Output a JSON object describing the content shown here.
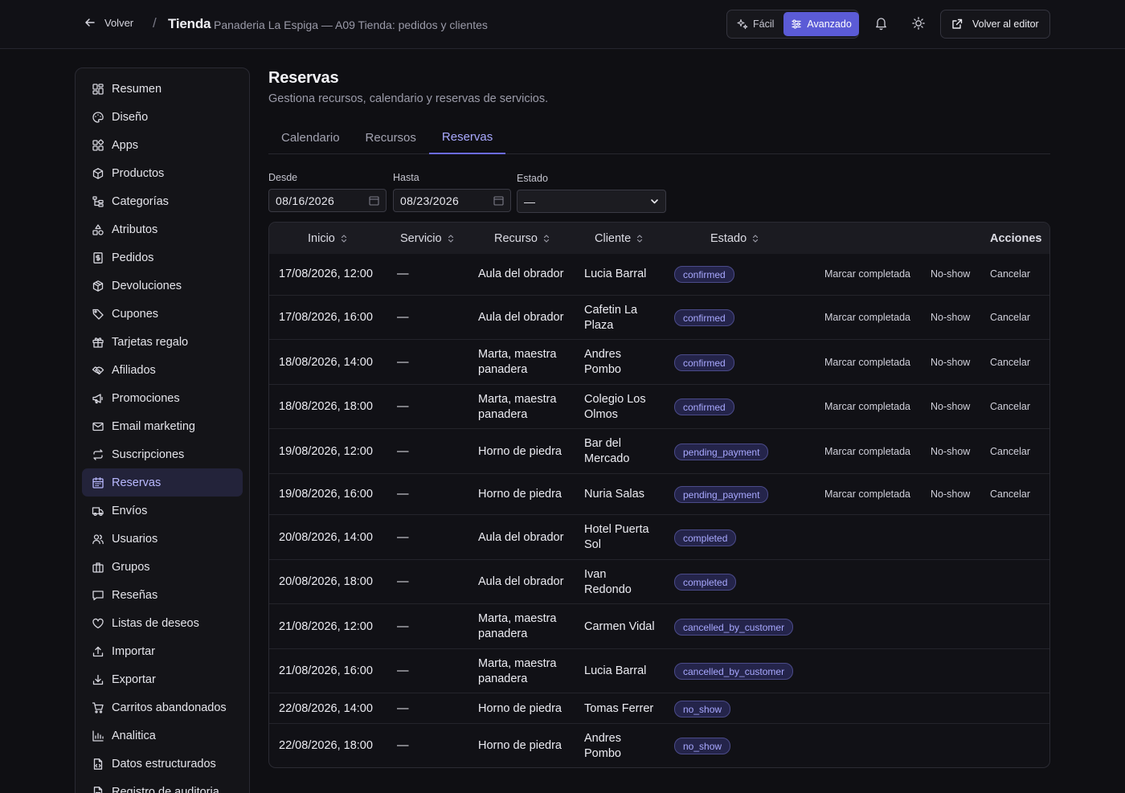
{
  "header": {
    "back_label": "Volver",
    "separator": "/",
    "title": "Tienda",
    "subtitle": "Panaderia La Espiga — A09 Tienda: pedidos y clientes",
    "mode_easy": "Fácil",
    "mode_advanced": "Avanzado",
    "editor_button": "Volver al editor"
  },
  "sidebar": {
    "items": [
      {
        "label": "Resumen",
        "icon": "dashboard-icon"
      },
      {
        "label": "Diseño",
        "icon": "palette-icon"
      },
      {
        "label": "Apps",
        "icon": "apps-icon"
      },
      {
        "label": "Productos",
        "icon": "box-icon"
      },
      {
        "label": "Categorías",
        "icon": "tree-icon"
      },
      {
        "label": "Atributos",
        "icon": "shapes-icon"
      },
      {
        "label": "Pedidos",
        "icon": "receipt-icon"
      },
      {
        "label": "Devoluciones",
        "icon": "return-box-icon"
      },
      {
        "label": "Cupones",
        "icon": "tag-icon"
      },
      {
        "label": "Tarjetas regalo",
        "icon": "gift-icon"
      },
      {
        "label": "Afiliados",
        "icon": "handshake-icon"
      },
      {
        "label": "Promociones",
        "icon": "megaphone-icon"
      },
      {
        "label": "Email marketing",
        "icon": "mail-icon"
      },
      {
        "label": "Suscripciones",
        "icon": "repeat-icon"
      },
      {
        "label": "Reservas",
        "icon": "calendar-icon",
        "active": true
      },
      {
        "label": "Envíos",
        "icon": "truck-icon"
      },
      {
        "label": "Usuarios",
        "icon": "users-icon"
      },
      {
        "label": "Grupos",
        "icon": "groups-icon"
      },
      {
        "label": "Reseñas",
        "icon": "message-icon"
      },
      {
        "label": "Listas de deseos",
        "icon": "heart-icon"
      },
      {
        "label": "Importar",
        "icon": "upload-icon"
      },
      {
        "label": "Exportar",
        "icon": "download-icon"
      },
      {
        "label": "Carritos abandonados",
        "icon": "cart-icon"
      },
      {
        "label": "Analitica",
        "icon": "bar-chart-icon"
      },
      {
        "label": "Datos estructurados",
        "icon": "file-code-icon"
      },
      {
        "label": "Registro de auditoria",
        "icon": "file-list-icon"
      }
    ]
  },
  "page": {
    "title": "Reservas",
    "subtitle": "Gestiona recursos, calendario y reservas de servicios.",
    "tabs": [
      {
        "label": "Calendario",
        "active": false
      },
      {
        "label": "Recursos",
        "active": false
      },
      {
        "label": "Reservas",
        "active": true
      }
    ]
  },
  "filters": {
    "from_label": "Desde",
    "from_value": "08/16/2026",
    "to_label": "Hasta",
    "to_value": "08/23/2026",
    "status_label": "Estado",
    "status_value": "—"
  },
  "table": {
    "headers": {
      "start": "Inicio",
      "service": "Servicio",
      "resource": "Recurso",
      "client": "Cliente",
      "status": "Estado",
      "actions": "Acciones"
    },
    "action_labels": {
      "complete": "Marcar completada",
      "no_show": "No-show",
      "cancel": "Cancelar"
    },
    "rows": [
      {
        "start": "17/08/2026, 12:00",
        "service": "—",
        "resource": [
          "Aula del obrador"
        ],
        "client": [
          "Lucia Barral"
        ],
        "status": "confirmed",
        "actions": true
      },
      {
        "start": "17/08/2026, 16:00",
        "service": "—",
        "resource": [
          "Aula del obrador"
        ],
        "client": [
          "Cafetin La",
          "Plaza"
        ],
        "status": "confirmed",
        "actions": true
      },
      {
        "start": "18/08/2026, 14:00",
        "service": "—",
        "resource": [
          "Marta, maestra",
          "panadera"
        ],
        "client": [
          "Andres",
          "Pombo"
        ],
        "status": "confirmed",
        "actions": true
      },
      {
        "start": "18/08/2026, 18:00",
        "service": "—",
        "resource": [
          "Marta, maestra",
          "panadera"
        ],
        "client": [
          "Colegio Los",
          "Olmos"
        ],
        "status": "confirmed",
        "actions": true
      },
      {
        "start": "19/08/2026, 12:00",
        "service": "—",
        "resource": [
          "Horno de piedra"
        ],
        "client": [
          "Bar del",
          "Mercado"
        ],
        "status": "pending_payment",
        "actions": true
      },
      {
        "start": "19/08/2026, 16:00",
        "service": "—",
        "resource": [
          "Horno de piedra"
        ],
        "client": [
          "Nuria Salas"
        ],
        "status": "pending_payment",
        "actions": true
      },
      {
        "start": "20/08/2026, 14:00",
        "service": "—",
        "resource": [
          "Aula del obrador"
        ],
        "client": [
          "Hotel Puerta",
          "Sol"
        ],
        "status": "completed",
        "actions": false
      },
      {
        "start": "20/08/2026, 18:00",
        "service": "—",
        "resource": [
          "Aula del obrador"
        ],
        "client": [
          "Ivan",
          "Redondo"
        ],
        "status": "completed",
        "actions": false
      },
      {
        "start": "21/08/2026, 12:00",
        "service": "—",
        "resource": [
          "Marta, maestra",
          "panadera"
        ],
        "client": [
          "Carmen Vidal"
        ],
        "status": "cancelled_by_customer",
        "actions": false
      },
      {
        "start": "21/08/2026, 16:00",
        "service": "—",
        "resource": [
          "Marta, maestra",
          "panadera"
        ],
        "client": [
          "Lucia Barral"
        ],
        "status": "cancelled_by_customer",
        "actions": false
      },
      {
        "start": "22/08/2026, 14:00",
        "service": "—",
        "resource": [
          "Horno de piedra"
        ],
        "client": [
          "Tomas Ferrer"
        ],
        "status": "no_show",
        "actions": false
      },
      {
        "start": "22/08/2026, 18:00",
        "service": "—",
        "resource": [
          "Horno de piedra"
        ],
        "client": [
          "Andres",
          "Pombo"
        ],
        "status": "no_show",
        "actions": false
      }
    ]
  },
  "colors": {
    "accent": "#5b5bd6",
    "accent_text": "#a9a9ff",
    "background": "#0f0f13",
    "badge_bg": "#24244a"
  }
}
